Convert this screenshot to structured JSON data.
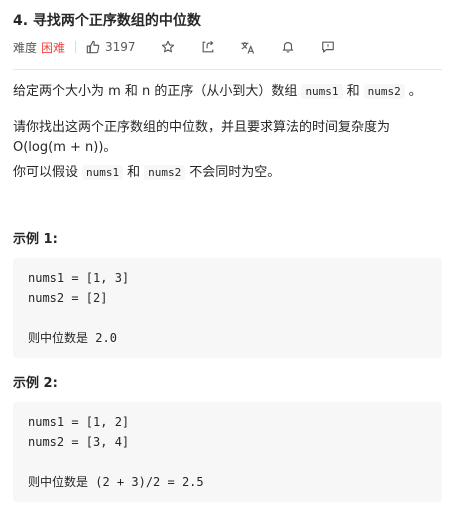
{
  "problem": {
    "title": "4. 寻找两个正序数组的中位数",
    "difficulty_label": "难度",
    "difficulty_value": "困难",
    "likes": "3197"
  },
  "icons": {
    "like": "thumbs-up-icon",
    "favorite": "star-icon",
    "share": "share-icon",
    "translate": "translate-icon",
    "notify": "bell-icon",
    "feedback": "feedback-icon"
  },
  "colors": {
    "hard": "#ef4743",
    "text": "#262626",
    "code_bg": "#f7f7f8"
  },
  "description": {
    "p1_a": "给定两个大小为 m 和 n 的正序（从小到大）数组",
    "p1_code1": "nums1",
    "p1_and": "和",
    "p1_code2": "nums2",
    "p1_end": "。",
    "p2": "请你找出这两个正序数组的中位数，并且要求算法的时间复杂度为 O(log(m + n))。",
    "p3_a": "你可以假设",
    "p3_code1": "nums1",
    "p3_and": "和",
    "p3_code2": "nums2",
    "p3_end": "不会同时为空。"
  },
  "examples": [
    {
      "title": "示例 1:",
      "line1": "nums1 = [1, 3]",
      "line2": "nums2 = [2]",
      "result_label": "则中位数是",
      "result_value": "2.0"
    },
    {
      "title": "示例 2:",
      "line1": "nums1 = [1, 2]",
      "line2": "nums2 = [3, 4]",
      "result_label": "则中位数是",
      "result_value": "(2 + 3)/2 = 2.5"
    }
  ]
}
